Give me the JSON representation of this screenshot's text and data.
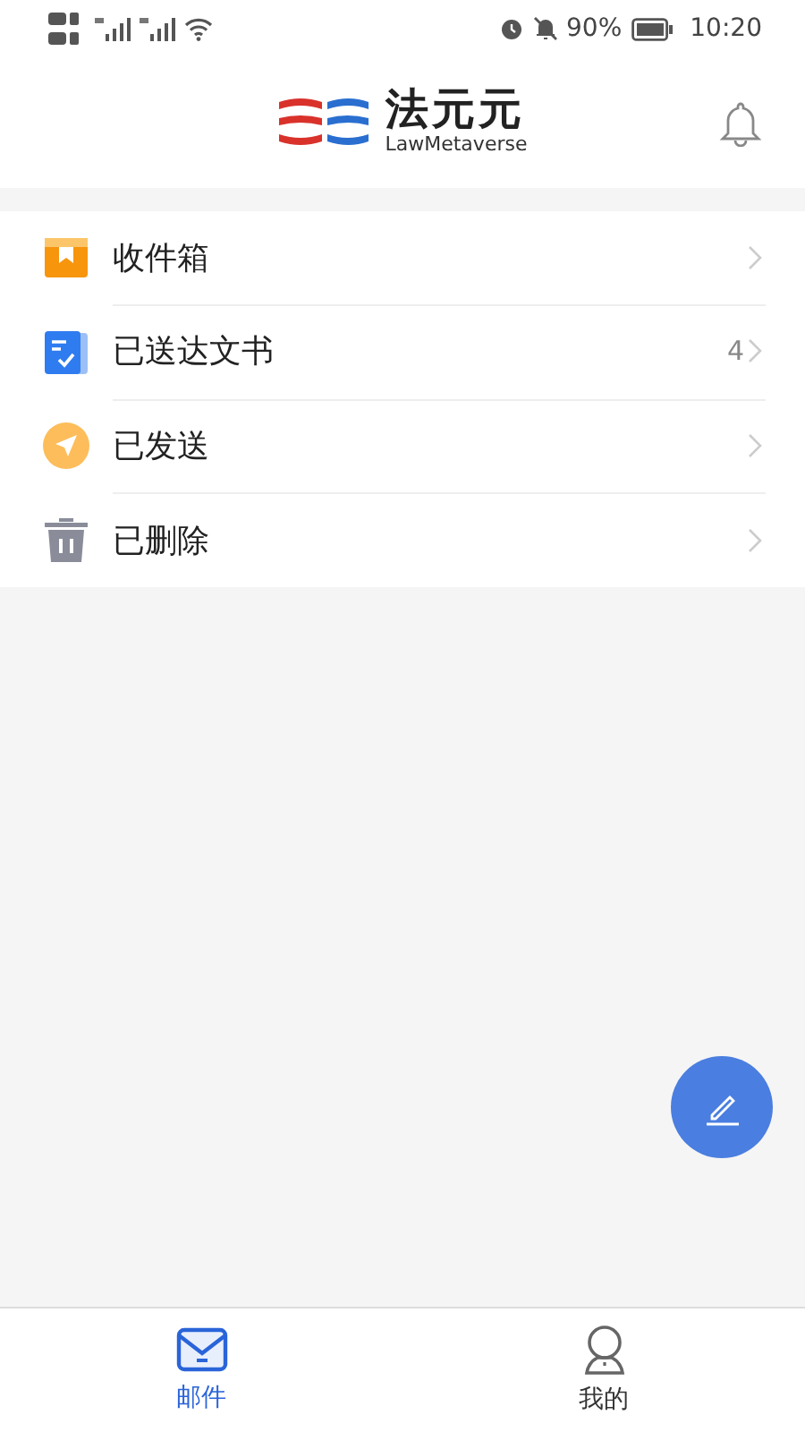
{
  "status_bar": {
    "battery_text": "90%",
    "time": "10:20"
  },
  "header": {
    "logo_title": "法元元",
    "logo_subtitle": "LawMetaverse"
  },
  "menu": [
    {
      "kind": "inbox",
      "label": "收件箱"
    },
    {
      "kind": "documents",
      "label": "已送达文书",
      "count": "4"
    },
    {
      "kind": "sent",
      "label": "已发送"
    },
    {
      "kind": "deleted",
      "label": "已删除"
    }
  ],
  "tabs": [
    {
      "kind": "mail",
      "label": "邮件",
      "selected": true
    },
    {
      "kind": "profile",
      "label": "我的",
      "selected": false
    }
  ]
}
